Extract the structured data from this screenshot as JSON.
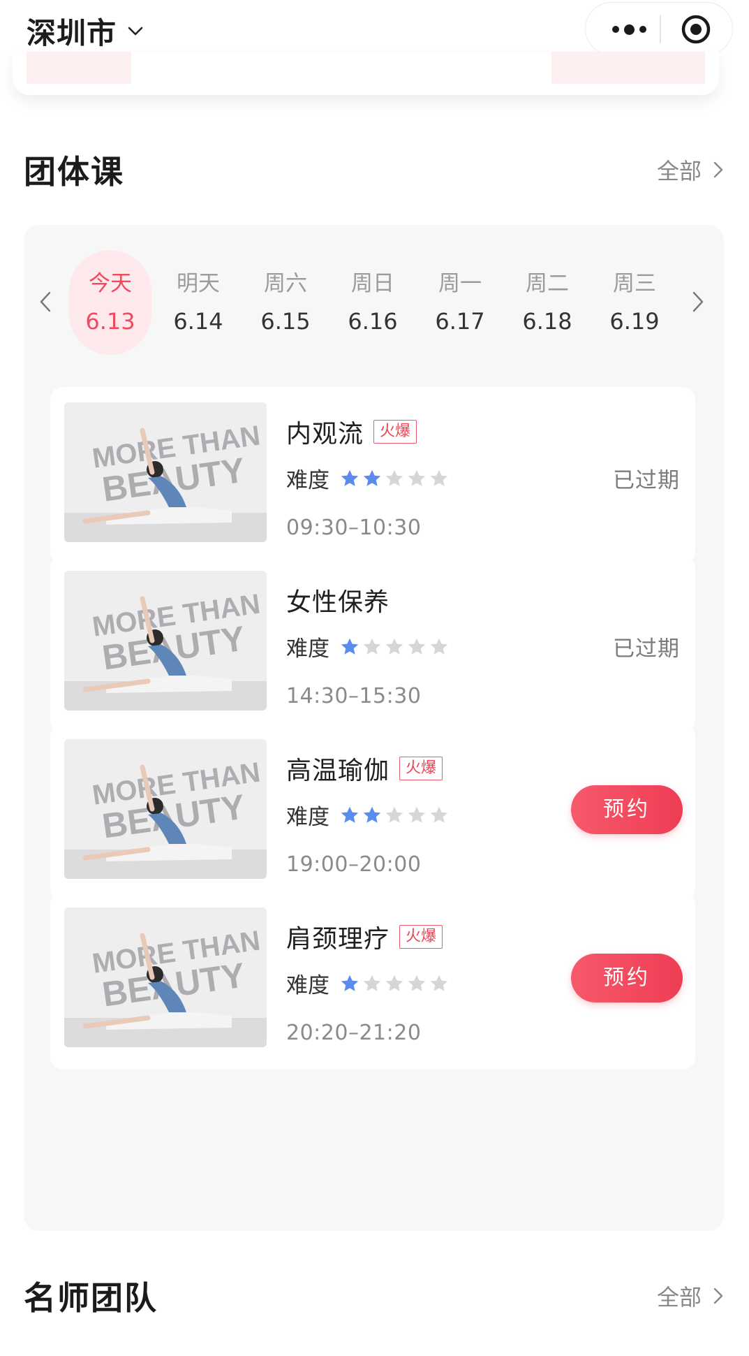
{
  "header": {
    "city": "深圳市"
  },
  "group_classes": {
    "title": "团体课",
    "more_label": "全部",
    "dates": [
      {
        "day": "今天",
        "date": "6.13",
        "active": true
      },
      {
        "day": "明天",
        "date": "6.14"
      },
      {
        "day": "周六",
        "date": "6.15"
      },
      {
        "day": "周日",
        "date": "6.16"
      },
      {
        "day": "周一",
        "date": "6.17"
      },
      {
        "day": "周二",
        "date": "6.18"
      },
      {
        "day": "周三",
        "date": "6.19"
      }
    ],
    "difficulty_label": "难度",
    "courses": [
      {
        "title": "内观流",
        "tag": "火爆",
        "difficulty": 2,
        "difficulty_max": 5,
        "time": "09:30–10:30",
        "status": "已过期"
      },
      {
        "title": "女性保养",
        "tag": "",
        "difficulty": 1,
        "difficulty_max": 5,
        "time": "14:30–15:30",
        "status": "已过期"
      },
      {
        "title": "高温瑜伽",
        "tag": "火爆",
        "difficulty": 2,
        "difficulty_max": 5,
        "time": "19:00–20:00",
        "action": "预约"
      },
      {
        "title": "肩颈理疗",
        "tag": "火爆",
        "difficulty": 1,
        "difficulty_max": 5,
        "time": "20:20–21:20",
        "action": "预约"
      }
    ],
    "thumbnail_text": [
      "MORE THAN",
      "BEAUTY"
    ]
  },
  "teachers": {
    "title": "名师团队",
    "more_label": "全部"
  },
  "colors": {
    "accent": "#ee4a5e",
    "star_active": "#5a8cf0",
    "star_inactive": "#d6d6d6",
    "panel_bg": "#f7f7f8"
  },
  "icons": {
    "city_dropdown": "chevron-down-icon",
    "capsule_more": "more-dots-icon",
    "capsule_close": "target-circle-icon",
    "section_more": "chevron-right-icon",
    "date_prev": "chevron-left-icon",
    "date_next": "chevron-right-icon",
    "star": "star-icon"
  }
}
